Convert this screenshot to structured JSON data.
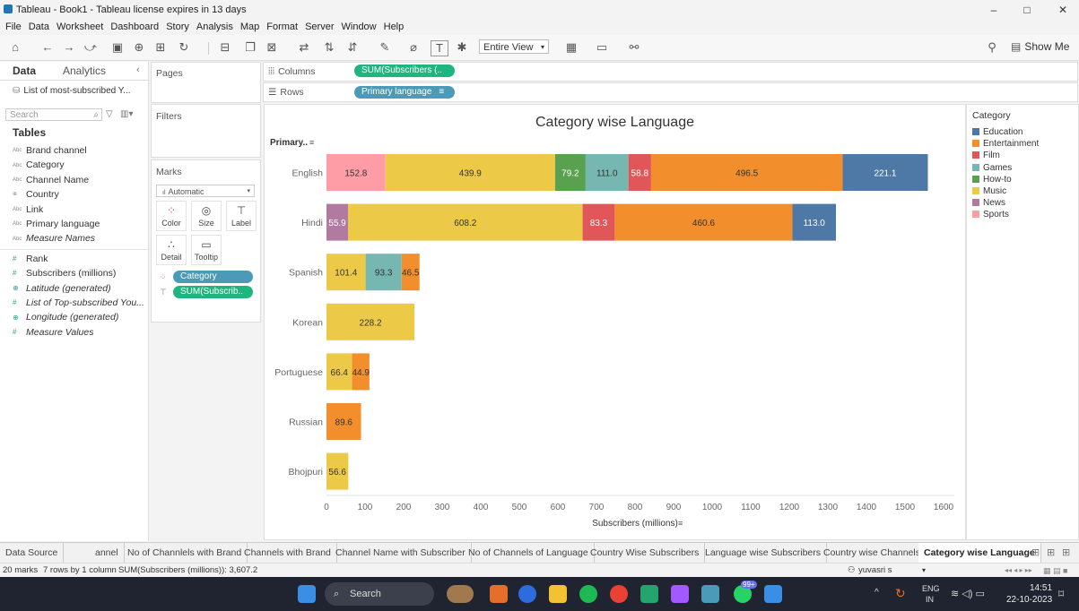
{
  "window": {
    "title": "Tableau - Book1 - Tableau license expires in 13 days",
    "minimize": "–",
    "maximize": "□",
    "close": "✕"
  },
  "menu": [
    "File",
    "Data",
    "Worksheet",
    "Dashboard",
    "Story",
    "Analysis",
    "Map",
    "Format",
    "Server",
    "Window",
    "Help"
  ],
  "toolbar": {
    "view_select": "Entire View",
    "show_me": "Show Me"
  },
  "data_pane": {
    "tab_data": "Data",
    "tab_analytics": "Analytics",
    "datasource": "List of most-subscribed Y...",
    "search_placeholder": "Search",
    "tables_heading": "Tables",
    "dimensions": [
      {
        "type": "Abc",
        "name": "Brand channel",
        "italic": false
      },
      {
        "type": "Abc",
        "name": "Category",
        "italic": false
      },
      {
        "type": "Abc",
        "name": "Channel Name",
        "italic": false
      },
      {
        "type": "⊕",
        "name": "Country",
        "italic": false
      },
      {
        "type": "Abc",
        "name": "Link",
        "italic": false
      },
      {
        "type": "Abc",
        "name": "Primary language",
        "italic": false
      },
      {
        "type": "Abc",
        "name": "Measure Names",
        "italic": true
      }
    ],
    "measures": [
      {
        "type": "#",
        "name": "Rank",
        "italic": false
      },
      {
        "type": "#",
        "name": "Subscribers (millions)",
        "italic": false
      },
      {
        "type": "⊕",
        "name": "Latitude (generated)",
        "italic": true
      },
      {
        "type": "#",
        "name": "List of Top-subscribed You...",
        "italic": true
      },
      {
        "type": "⊕",
        "name": "Longitude (generated)",
        "italic": true
      },
      {
        "type": "#",
        "name": "Measure Values",
        "italic": true
      }
    ]
  },
  "pages": {
    "title": "Pages"
  },
  "filters": {
    "title": "Filters"
  },
  "marks": {
    "title": "Marks",
    "type": "Automatic",
    "buttons": [
      "Color",
      "Size",
      "Label",
      "Detail",
      "Tooltip"
    ],
    "pill_category": "Category",
    "pill_sum": "SUM(Subscrib.."
  },
  "shelves": {
    "columns_label": "Columns",
    "columns_pill": "SUM(Subscribers (..",
    "rows_label": "Rows",
    "rows_pill": "Primary language"
  },
  "chart_data": {
    "type": "bar",
    "orientation": "horizontal-stacked",
    "title": "Category  wise Language",
    "ylabel": "Primary..",
    "xlabel": "Subscribers (millions)",
    "xlim": [
      0,
      1600
    ],
    "xticks": [
      0,
      100,
      200,
      300,
      400,
      500,
      600,
      700,
      800,
      900,
      1000,
      1100,
      1200,
      1300,
      1400,
      1500,
      1600
    ],
    "categories": [
      "English",
      "Hindi",
      "Spanish",
      "Korean",
      "Portuguese",
      "Russian",
      "Bhojpuri"
    ],
    "legend_title": "Category",
    "series": [
      {
        "name": "Sports",
        "color": "#ff9da7",
        "values": [
          152.8,
          0,
          0,
          0,
          0,
          0,
          0
        ]
      },
      {
        "name": "News",
        "color": "#b07aa1",
        "values": [
          0,
          55.9,
          0,
          0,
          0,
          0,
          0
        ]
      },
      {
        "name": "Music",
        "color": "#edc948",
        "values": [
          439.9,
          608.2,
          101.4,
          228.2,
          66.4,
          0,
          56.6
        ]
      },
      {
        "name": "How-to",
        "color": "#59a14f",
        "values": [
          79.2,
          0,
          0,
          0,
          0,
          0,
          0
        ]
      },
      {
        "name": "Games",
        "color": "#76b7b2",
        "values": [
          111.0,
          0,
          93.3,
          0,
          0,
          0,
          0
        ]
      },
      {
        "name": "Film",
        "color": "#e15759",
        "values": [
          58.8,
          83.3,
          0,
          0,
          0,
          0,
          0
        ]
      },
      {
        "name": "Entertainment",
        "color": "#f28e2b",
        "values": [
          496.5,
          460.6,
          46.5,
          0,
          44.9,
          89.6,
          0
        ]
      },
      {
        "name": "Education",
        "color": "#4e79a7",
        "values": [
          221.1,
          113.0,
          0,
          0,
          0,
          0,
          0
        ]
      }
    ],
    "legend_order": [
      "Education",
      "Entertainment",
      "Film",
      "Games",
      "How-to",
      "Music",
      "News",
      "Sports"
    ]
  },
  "sheet_tabs": [
    "Data Source",
    "annel",
    "No of Channlels with Brand",
    "Channels with Brand",
    "Channel Name with Subscriber",
    "No of Channels of Language",
    "Country Wise Subscribers",
    "Language wise Subscribers",
    "Country wise Channels",
    "Category  wise Language"
  ],
  "status": {
    "marks": "20 marks",
    "rowscols": "7 rows by 1 column",
    "sum": "SUM(Subscribers (millions)): 3,607.2",
    "user": "yuvasri s"
  },
  "taskbar": {
    "search": "Search",
    "lang1": "ENG",
    "lang2": "IN",
    "time": "14:51",
    "date": "22-10-2023",
    "badge": "99+"
  }
}
